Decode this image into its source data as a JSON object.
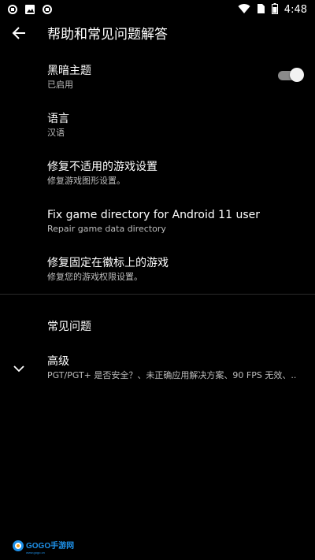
{
  "status_bar": {
    "time": "4:48",
    "left_icons": [
      "sync-icon",
      "image-icon",
      "sync-icon"
    ],
    "right_icons": [
      "wifi-icon",
      "sim-icon",
      "battery-icon"
    ]
  },
  "app_bar": {
    "title": "帮助和常见问题解答",
    "back_icon": "arrow-back-icon"
  },
  "settings": [
    {
      "title": "黑暗主题",
      "summary": "已启用",
      "toggle_on": true
    },
    {
      "title": "语言",
      "summary": "汉语"
    },
    {
      "title": "修复不适用的游戏设置",
      "summary": "修复游戏图形设置。"
    },
    {
      "title": "Fix game directory for Android 11 user",
      "summary": "Repair game data directory"
    },
    {
      "title": "修复固定在徽标上的游戏",
      "summary": "修复您的游戏权限设置。"
    }
  ],
  "faq": {
    "header": "常见问题",
    "advanced": {
      "title": "高级",
      "summary": "PGT/PGT+ 是否安全？、未正确应用解决方案、90 FPS 无效、..",
      "icon": "chevron-down-icon"
    }
  },
  "watermark": {
    "text": "GOGO手游网",
    "subtext": "www.gogo.cn"
  },
  "colors": {
    "background": "#000000",
    "text_primary": "#ffffff",
    "text_secondary": "#bdbdbd",
    "toggle_track": "#8a8a8a",
    "toggle_thumb": "#f2f2f2",
    "watermark_blue": "#1e90e8"
  }
}
